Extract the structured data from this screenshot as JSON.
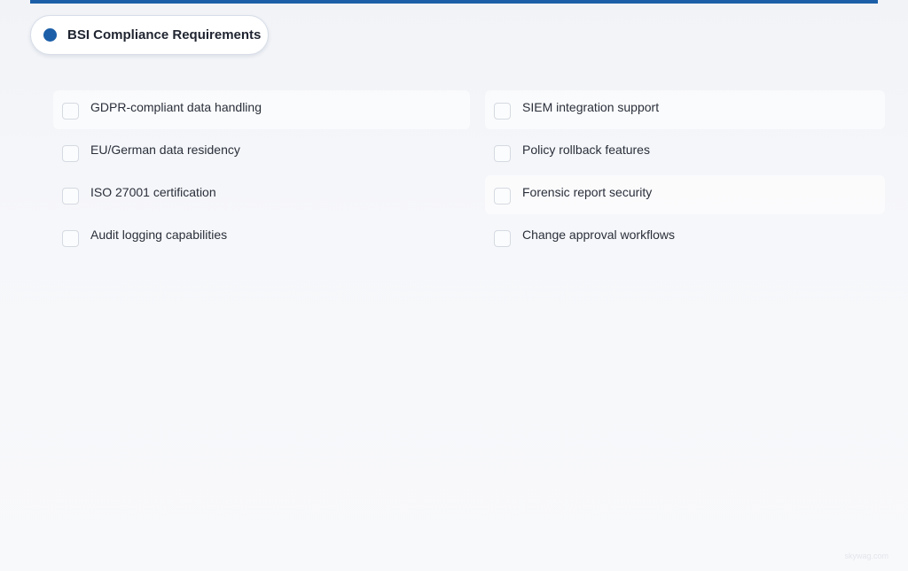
{
  "section": {
    "title": "BSI Compliance Requirements"
  },
  "requirements": {
    "left": [
      {
        "label": "GDPR-compliant data handling",
        "checked": false
      },
      {
        "label": "EU/German data residency",
        "checked": false
      },
      {
        "label": "ISO 27001 certification",
        "checked": false
      },
      {
        "label": "Audit logging capabilities",
        "checked": false
      }
    ],
    "right": [
      {
        "label": "SIEM integration support",
        "checked": false
      },
      {
        "label": "Policy rollback features",
        "checked": false
      },
      {
        "label": "Forensic report security",
        "checked": false
      },
      {
        "label": "Change approval workflows",
        "checked": false
      }
    ]
  },
  "watermark": "skywag.com",
  "colors": {
    "accent": "#1c5fa8",
    "text": "#2a2f3a",
    "title": "#1f2430"
  }
}
